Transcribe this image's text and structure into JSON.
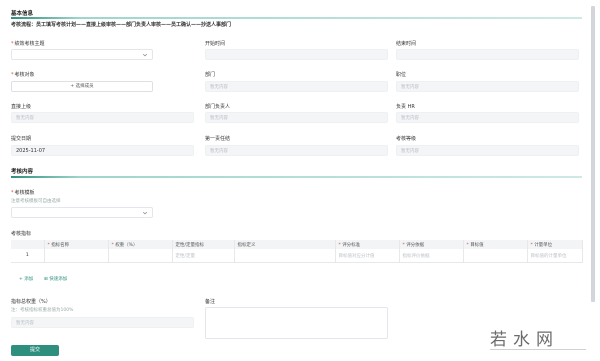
{
  "basic": {
    "title": "基本信息",
    "flow": "考核流程：员工填写考核计划——直接上级审核——部门负责人审核——员工确认——抄送人事部门"
  },
  "form": {
    "theme": {
      "label": "绩效考核主题",
      "required": true
    },
    "start_time": {
      "label": "开始时间"
    },
    "end_time": {
      "label": "结束时间"
    },
    "object": {
      "label": "考核对象",
      "required": true,
      "button": "选择成员"
    },
    "dept": {
      "label": "部门",
      "placeholder": "暂无内容"
    },
    "position": {
      "label": "职位",
      "placeholder": "暂无内容"
    },
    "superior": {
      "label": "直接上级",
      "placeholder": "暂无内容"
    },
    "dept_head": {
      "label": "部门负责人",
      "placeholder": "暂无内容"
    },
    "hr": {
      "label": "负责 HR",
      "placeholder": "暂无内容"
    },
    "submit_date": {
      "label": "提交日期",
      "value": "2025-11-07"
    },
    "first_result": {
      "label": "第一责任结",
      "placeholder": "暂无内容"
    },
    "grade": {
      "label": "考核等级",
      "placeholder": "暂无内容"
    }
  },
  "content": {
    "title": "考核内容",
    "template": {
      "label": "考核模板",
      "hint": "注意考核模板可自由选择"
    },
    "indicators": {
      "label": "考核指标",
      "columns": [
        "",
        "指标名称",
        "权重（%）",
        "定性/定量指标",
        "指标定义",
        "评分标准",
        "评分依据",
        "目标值",
        "计量单位"
      ],
      "required_cols": [
        1,
        2,
        5,
        6,
        7,
        8
      ],
      "row": [
        "1",
        "",
        "",
        "定性/定量",
        "",
        "目标值对应分计值",
        "指标评价依据",
        "",
        "目标值的计量单位"
      ],
      "add": "添加",
      "quick_add": "快速添加"
    },
    "total_weight": {
      "label": "指标总权重（%）",
      "hint": "注：考核指标权重总值为100%",
      "placeholder": "暂无内容"
    },
    "remark": {
      "label": "备注"
    }
  },
  "actions": {
    "submit": "提交"
  },
  "watermark": {
    "text": "若水网"
  },
  "colors": {
    "accent": "#2f8f7e",
    "required": "#e0453b"
  }
}
